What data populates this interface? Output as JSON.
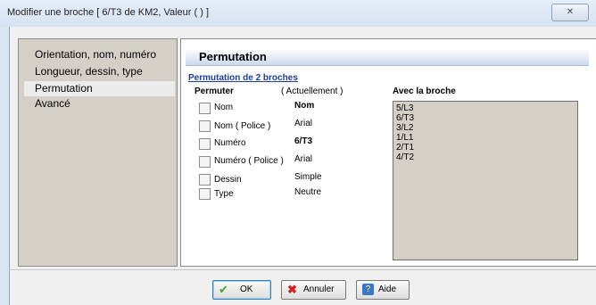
{
  "window": {
    "title": "Modifier une broche  [ 6/T3 de KM2, Valeur ( ) ]"
  },
  "sidebar": {
    "items": [
      {
        "label": "Orientation, nom, numéro"
      },
      {
        "label": "Longueur, dessin, type"
      },
      {
        "label": "Permutation"
      },
      {
        "label": "Avancé"
      }
    ],
    "selected": "Permutation"
  },
  "section": {
    "title": "Permutation",
    "link": "Permutation de 2 broches"
  },
  "columns": {
    "permuter": "Permuter",
    "current": "( Actuellement )",
    "with": "Avec la broche"
  },
  "rows": [
    {
      "label": "Nom",
      "value": "Nom",
      "checked": false
    },
    {
      "label": "Nom ( Police )",
      "value": "Arial",
      "checked": false
    },
    {
      "label": "Numéro",
      "value": "6/T3",
      "checked": false
    },
    {
      "label": "Numéro ( Police )",
      "value": "Arial",
      "checked": false
    },
    {
      "label": "Dessin",
      "value": "Simple",
      "checked": false
    },
    {
      "label": "Type",
      "value": "Neutre",
      "checked": false
    }
  ],
  "pins": [
    "5/L3",
    "6/T3",
    "3/L2",
    "1/L1",
    "2/T1",
    "4/T2"
  ],
  "buttons": {
    "ok": "OK",
    "cancel": "Annuler",
    "help": "Aide"
  },
  "icons": {
    "ok": "green-check-icon",
    "cancel": "red-x-icon",
    "help": "help-question-icon",
    "close": "close-icon"
  }
}
